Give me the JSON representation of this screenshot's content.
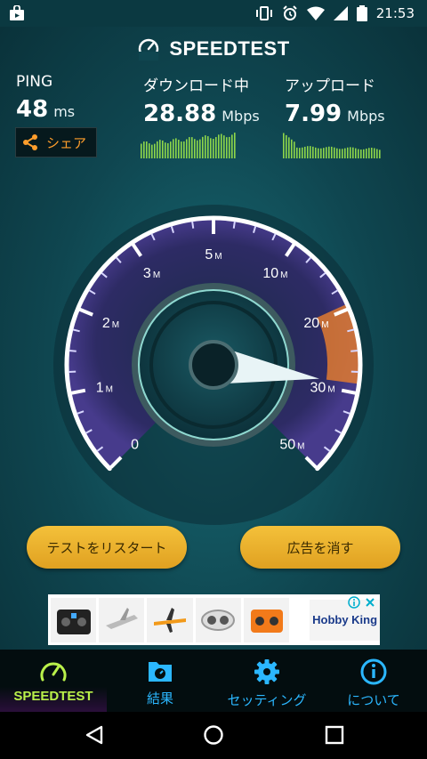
{
  "status_bar": {
    "time": "21:53"
  },
  "app": {
    "title": "SPEEDTEST"
  },
  "ping": {
    "label": "PING",
    "value": "48",
    "unit": "ms"
  },
  "download": {
    "label": "ダウンロード中",
    "value": "28.88",
    "unit": "Mbps"
  },
  "upload": {
    "label": "アップロード",
    "value": "7.99",
    "unit": "Mbps"
  },
  "share": {
    "label": "シェア"
  },
  "gauge": {
    "current_speed_mbps": 28.88,
    "ticks": [
      {
        "num": "0",
        "unit": ""
      },
      {
        "num": "1",
        "unit": "M"
      },
      {
        "num": "2",
        "unit": "M"
      },
      {
        "num": "3",
        "unit": "M"
      },
      {
        "num": "5",
        "unit": "M"
      },
      {
        "num": "10",
        "unit": "M"
      },
      {
        "num": "20",
        "unit": "M"
      },
      {
        "num": "30",
        "unit": "M"
      },
      {
        "num": "50",
        "unit": "M"
      }
    ]
  },
  "buttons": {
    "restart": "テストをリスタート",
    "remove_ads": "広告を消す"
  },
  "ad": {
    "brand": "Hobby King"
  },
  "nav": {
    "speedtest": "SPEEDTEST",
    "results": "結果",
    "settings": "セッティング",
    "about": "について"
  },
  "colors": {
    "accent_orange": "#ff9e2c",
    "nav_blue": "#2bb7ff",
    "active_green": "#b9f04a",
    "button_gold": "#f4c13a"
  }
}
